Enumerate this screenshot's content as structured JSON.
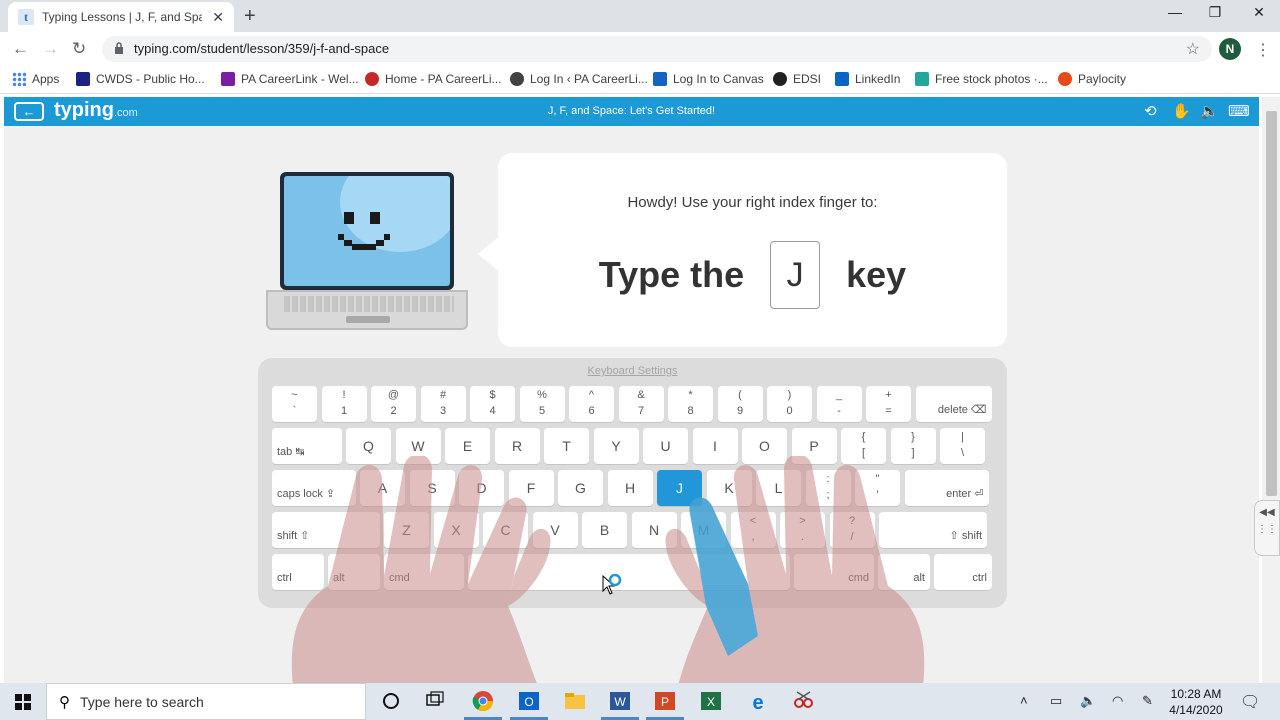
{
  "browser": {
    "tab_title": "Typing Lessons | J, F, and Space -",
    "tab_favicon_letter": "t",
    "url": "typing.com/student/lesson/359/j-f-and-space",
    "profile_initial": "N"
  },
  "bookmarks": [
    {
      "label": "Apps",
      "color": "#4285f4"
    },
    {
      "label": "CWDS - Public Ho...",
      "color": "#1a237e"
    },
    {
      "label": "PA CareerLink - Wel...",
      "color": "#7b1fa2"
    },
    {
      "label": "Home - PA CareerLi...",
      "color": "#c62828"
    },
    {
      "label": "Log In ‹ PA CareerLi...",
      "color": "#424242"
    },
    {
      "label": "Log In to Canvas",
      "color": "#1565c0"
    },
    {
      "label": "EDSI",
      "color": "#212121"
    },
    {
      "label": "LinkedIn",
      "color": "#0a66c2"
    },
    {
      "label": "Free stock photos ·...",
      "color": "#26a69a"
    },
    {
      "label": "Paylocity",
      "color": "#e64a19"
    }
  ],
  "site": {
    "logo": "typing",
    "logo_suffix": ".com",
    "lesson_title": "J, F, and Space: Let's Get Started!",
    "accent": "#1b9ad6"
  },
  "lesson": {
    "instruction": "Howdy! Use your right index finger to:",
    "prompt_before": "Type the",
    "prompt_key": "J",
    "prompt_after": "key"
  },
  "keyboard": {
    "settings_link": "Keyboard Settings",
    "active_key": "J",
    "row1": [
      {
        "top": "~",
        "bot": "`"
      },
      {
        "top": "!",
        "bot": "1"
      },
      {
        "top": "@",
        "bot": "2"
      },
      {
        "top": "#",
        "bot": "3"
      },
      {
        "top": "$",
        "bot": "4"
      },
      {
        "top": "%",
        "bot": "5"
      },
      {
        "top": "^",
        "bot": "6"
      },
      {
        "top": "&",
        "bot": "7"
      },
      {
        "top": "*",
        "bot": "8"
      },
      {
        "top": "(",
        "bot": "9"
      },
      {
        "top": ")",
        "bot": "0"
      },
      {
        "top": "_",
        "bot": "-"
      },
      {
        "top": "+",
        "bot": "="
      }
    ],
    "delete_label": "delete ⌫",
    "tab_label": "tab ↹",
    "row2": [
      "Q",
      "W",
      "E",
      "R",
      "T",
      "Y",
      "U",
      "I",
      "O",
      "P"
    ],
    "row2_sym": [
      {
        "top": "{",
        "bot": "["
      },
      {
        "top": "}",
        "bot": "]"
      },
      {
        "top": "|",
        "bot": "\\"
      }
    ],
    "caps_label": "caps lock ⇪",
    "row3": [
      "A",
      "S",
      "D",
      "F",
      "G",
      "H",
      "J",
      "K",
      "L"
    ],
    "row3_sym": [
      {
        "top": ":",
        "bot": ";"
      },
      {
        "top": "\"",
        "bot": "'"
      }
    ],
    "enter_label": "enter ⏎",
    "shift_left_label": "shift ⇧",
    "row4": [
      "Z",
      "X",
      "C",
      "V",
      "B",
      "N",
      "M"
    ],
    "row4_sym": [
      {
        "top": "<",
        "bot": ","
      },
      {
        "top": ">",
        "bot": "."
      },
      {
        "top": "?",
        "bot": "/"
      }
    ],
    "shift_right_label": "⇧ shift",
    "row5": {
      "ctrl_l": "ctrl",
      "alt_l": "alt",
      "cmd_l": "cmd",
      "cmd_r": "cmd",
      "alt_r": "alt",
      "ctrl_r": "ctrl"
    }
  },
  "taskbar": {
    "search_placeholder": "Type here to search",
    "time": "10:28 AM",
    "date": "4/14/2020"
  }
}
